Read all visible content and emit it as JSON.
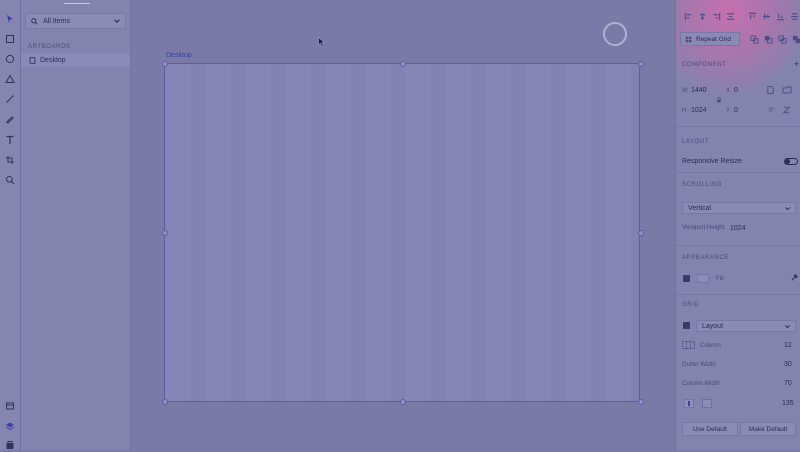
{
  "layers_panel": {
    "search_value": "All Items",
    "artboards_heading": "ARTBOARDS",
    "artboards": [
      {
        "label": "Desktop"
      }
    ]
  },
  "canvas": {
    "artboard_title": "Desktop"
  },
  "inspector": {
    "repeat_grid_label": "Repeat Grid",
    "component_heading": "COMPONENT",
    "w_label": "W",
    "w_value": "1440",
    "x_label": "X",
    "x_value": "0",
    "h_label": "H",
    "h_value": "1024",
    "y_label": "Y",
    "y_value": "0",
    "rotation_label": "0°",
    "layout_heading": "LAYOUT",
    "responsive_resize_label": "Responsive Resize",
    "scrolling_heading": "SCROLLING",
    "scrolling_value": "Vertical",
    "viewport_height_label": "Viewport Height",
    "viewport_height_value": "1024",
    "appearance_heading": "APPEARANCE",
    "fill_label": "Fill",
    "grid_heading": "GRID",
    "grid_type_value": "Layout",
    "columns_label": "Column",
    "columns_value": "12",
    "gutter_width_label": "Gutter Width",
    "gutter_width_value": "30",
    "column_width_label": "Column Width",
    "column_width_value": "70",
    "margin_value": "135",
    "use_default_label": "Use Default",
    "make_default_label": "Make Default"
  },
  "colors": {
    "overlay": "#7a7aa6",
    "accent": "#3a40a8",
    "highlight_blob": "#cd6eaf"
  }
}
